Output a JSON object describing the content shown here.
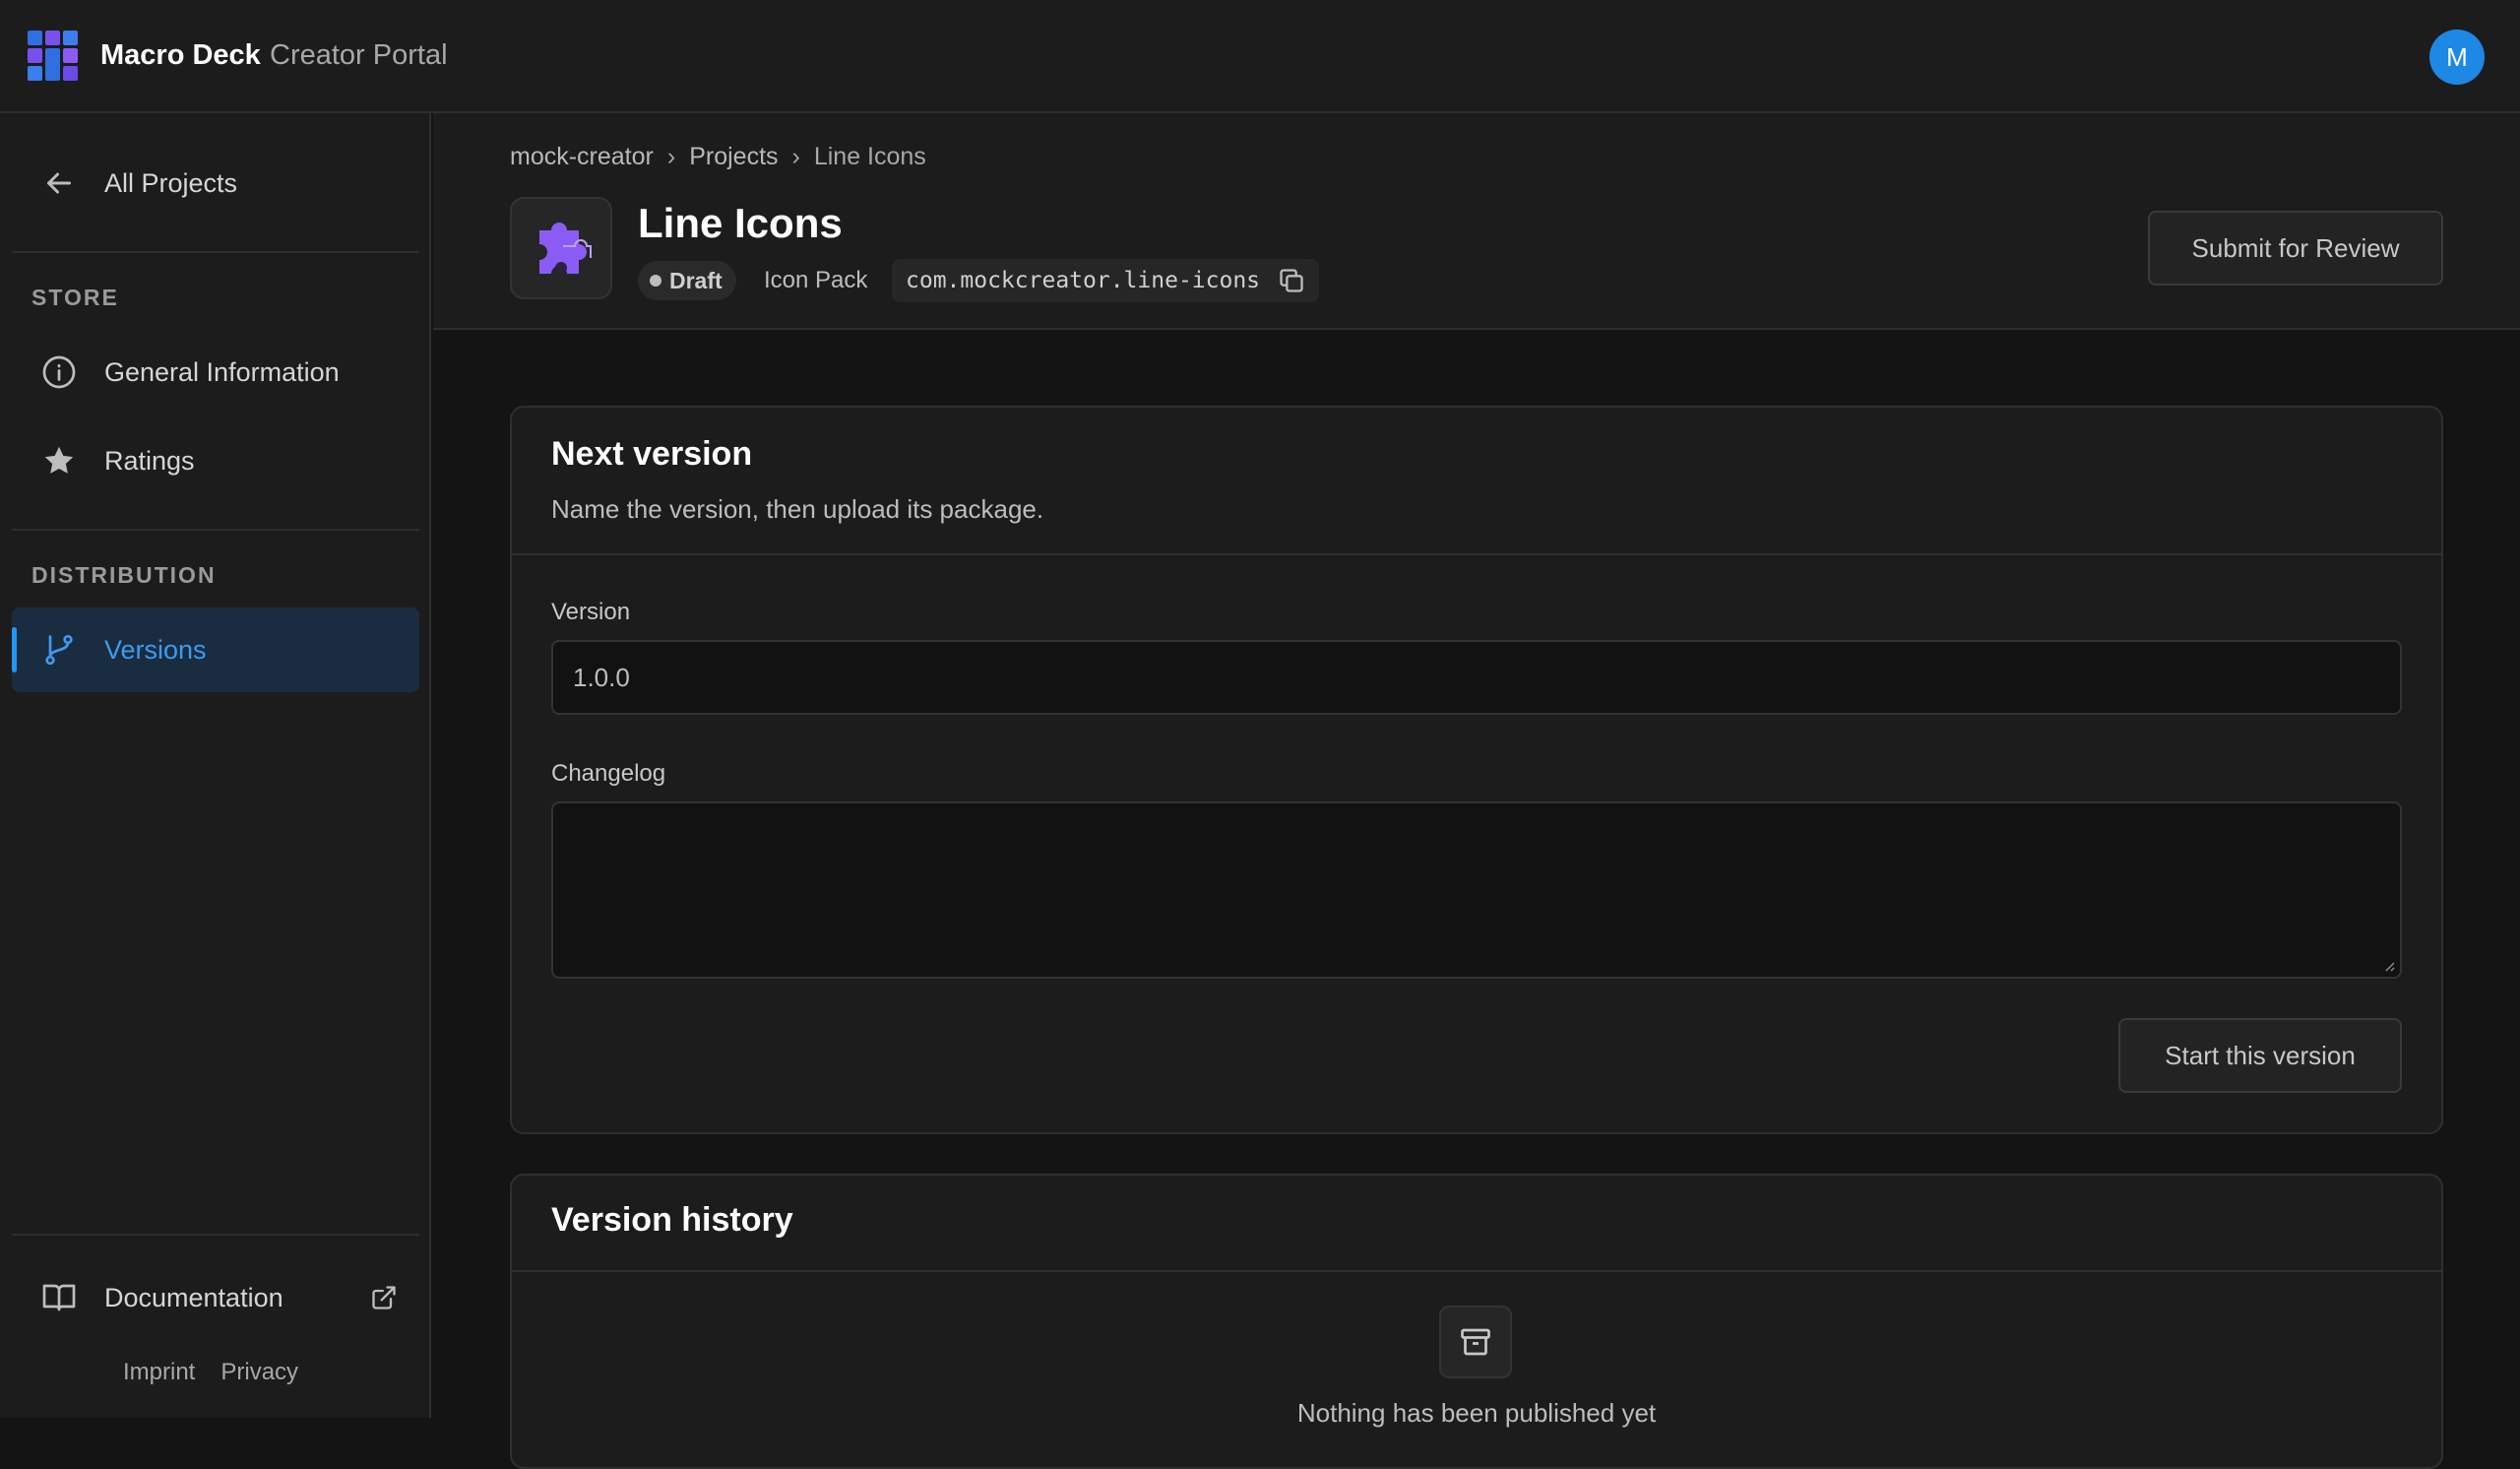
{
  "app": {
    "name": "Macro Deck",
    "subtitle": "Creator Portal",
    "avatar_initial": "M"
  },
  "sidebar": {
    "back": {
      "label": "All Projects",
      "icon": "arrow-left-icon"
    },
    "sections": [
      {
        "title": "STORE",
        "items": [
          {
            "label": "General Information",
            "icon": "info-icon"
          },
          {
            "label": "Ratings",
            "icon": "star-icon"
          }
        ]
      },
      {
        "title": "DISTRIBUTION",
        "items": [
          {
            "label": "Versions",
            "icon": "git-branch-icon",
            "active": true
          }
        ]
      }
    ],
    "documentation": {
      "label": "Documentation",
      "icon": "book-icon",
      "external_icon": "external-link-icon"
    },
    "footer": {
      "imprint": "Imprint",
      "privacy": "Privacy"
    }
  },
  "breadcrumb": [
    "mock-creator",
    "Projects",
    "Line Icons"
  ],
  "project": {
    "title": "Line Icons",
    "status": "Draft",
    "type": "Icon Pack",
    "package_id": "com.mockcreator.line-icons",
    "submit_label": "Submit for Review"
  },
  "next_version": {
    "title": "Next version",
    "description": "Name the version, then upload its package.",
    "version_label": "Version",
    "version_value": "1.0.0",
    "changelog_label": "Changelog",
    "changelog_value": "",
    "start_label": "Start this version"
  },
  "history": {
    "title": "Version history",
    "empty_text": "Nothing has been published yet"
  },
  "colors": {
    "accent": "#2196f3",
    "active_bg": "#1a2c40",
    "avatar": "#1e88e5",
    "logo_purple": "#7c4dff"
  }
}
